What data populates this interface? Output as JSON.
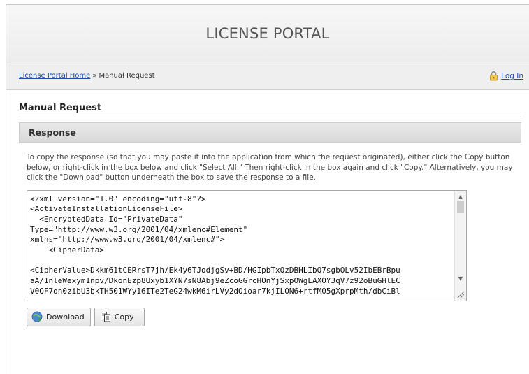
{
  "header": {
    "title": "LICENSE PORTAL"
  },
  "breadcrumb": {
    "home_link": "License Portal Home",
    "separator": "»",
    "current": "Manual Request"
  },
  "auth": {
    "login_label": "Log In",
    "icon": "lock-icon"
  },
  "page": {
    "section_title": "Manual Request"
  },
  "response": {
    "heading": "Response",
    "instructions": "To copy the response (so that you may paste it into the application from which the request originated), either click the Copy button below, or right-click in the box below and click \"Select All.\" Then right-click in the box again and click \"Copy.\" Alternatively, you may click the \"Download\" button underneath the box to save the response to a file.",
    "xml_lines": [
      "<?xml version=\"1.0\" encoding=\"utf-8\"?>",
      "<ActivateInstallationLicenseFile>",
      "  <EncryptedData Id=\"PrivateData\"",
      "Type=\"http://www.w3.org/2001/04/xmlenc#Element\"",
      "xmlns=\"http://www.w3.org/2001/04/xmlenc#\">",
      "    <CipherData>",
      "",
      "<CipherValue>Dkkm61tCERrsT7jh/Ek4y6TJodjgSv+BD/HGIpbTxQzDBHLIbQ7sgbOLv52IbEBrBpu",
      "aA/1nleWexym1npv/DkonEzp8Uxyb1XYN7sN8Abj9eZcoGGrcHOnYjSxpOWgLAXOY3qV7z92oBuGHlEC",
      "V0QF7on0zibU3bkTH501WYy16ITe2TeG24wkM6irLVy2dQioar7kjILON6+rtfM05gXprpMth/dbCiBl"
    ]
  },
  "buttons": {
    "download_label": "Download",
    "download_icon": "download-icon",
    "copy_label": "Copy",
    "copy_icon": "copy-icon"
  }
}
